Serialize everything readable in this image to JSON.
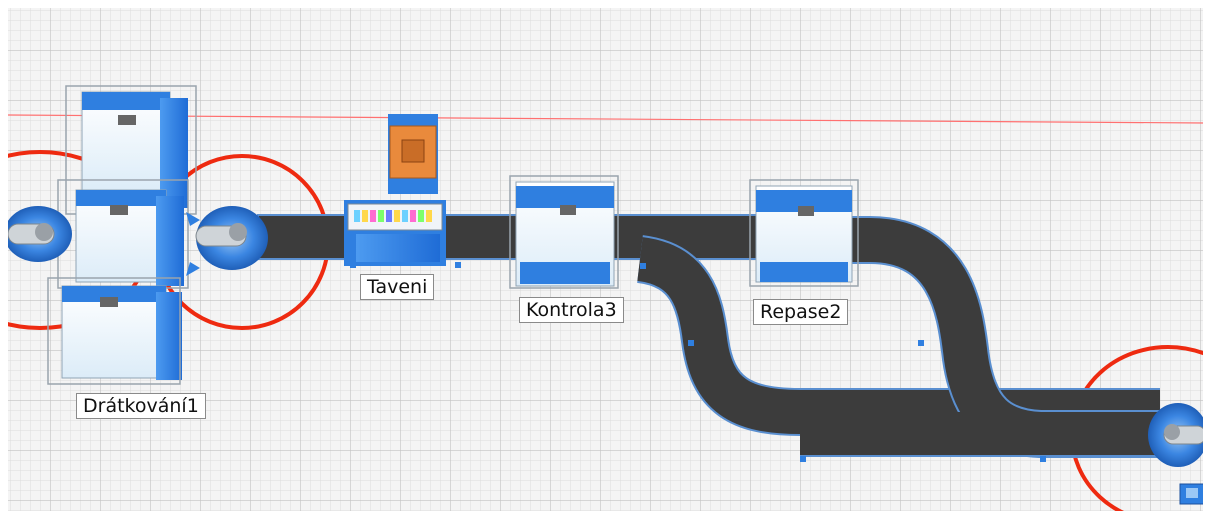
{
  "labels": {
    "dratkovani": "Drátkování1",
    "taveni": "Taveni",
    "kontrola": "Kontrola3",
    "repase": "Repase2"
  },
  "colors": {
    "grid_bg": "#f4f4f4",
    "grid_minor": "#dcdcdc",
    "grid_major": "#c2c2c2",
    "conveyor": "#3c3c3c",
    "conveyor_edge": "#5a8fd0",
    "machine_blue": "#2f7fe0",
    "machine_light": "#eaf3fb",
    "robot_ring": "#ee2a10",
    "boundary_line": "#ff7070",
    "crate": "#e98a3c"
  },
  "icons": {
    "robot": "robot-arm-icon",
    "machine": "workstation-icon",
    "crate": "crate-icon"
  }
}
